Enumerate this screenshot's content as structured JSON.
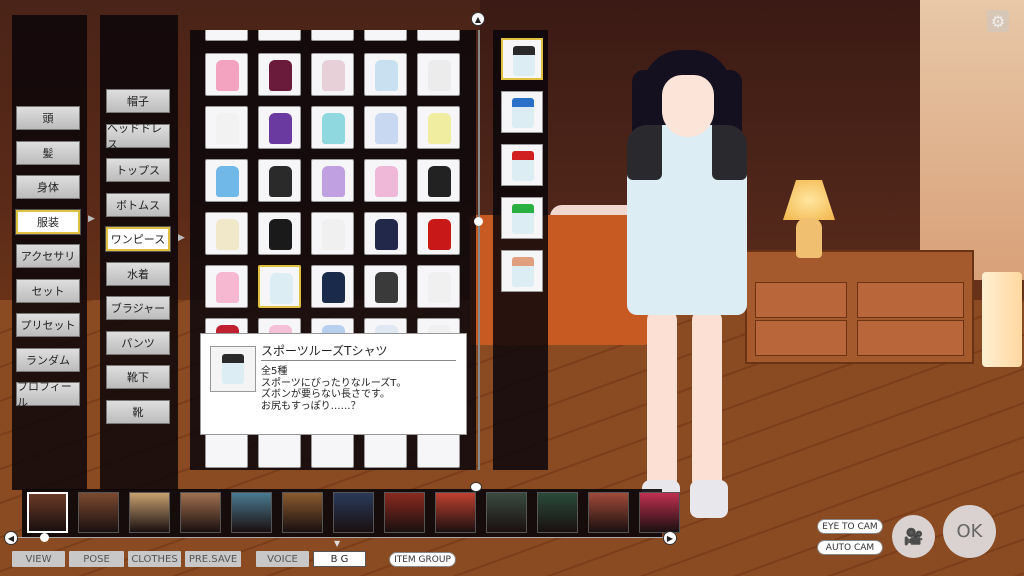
{
  "categories": [
    "頭",
    "髪",
    "身体",
    "服装",
    "アクセサリ",
    "セット",
    "プリセット",
    "ランダム",
    "プロフィール"
  ],
  "category_selected": 3,
  "subcategories": [
    "帽子",
    "ヘッドドレス",
    "トップス",
    "ボトムス",
    "ワンピース",
    "水着",
    "ブラジャー",
    "パンツ",
    "靴下",
    "靴"
  ],
  "subcategory_selected": 4,
  "item_colors": [
    [
      "#f3a3c0",
      "#6a1a3a",
      "#e8d0d8",
      "#c8e0f0",
      "#ececec"
    ],
    [
      "#f2f2f2",
      "#6a3aa0",
      "#90d8e0",
      "#c8d8f0",
      "#f0eca0"
    ],
    [
      "#70b8e8",
      "#2a2a2a",
      "#c0a0e0",
      "#f0b8d8",
      "#222222"
    ],
    [
      "#f0e8c8",
      "#1a1a1a",
      "#f0f0f0",
      "#22284a",
      "#c81818"
    ],
    [
      "#f6b8d0",
      "#dceef4",
      "#1a2a4a",
      "#3a3a3a",
      "#f0f0f0"
    ],
    [
      "#c02030",
      "#f4c0d8",
      "#b8d0f0",
      "#e0e8f4",
      "#f0f0f0"
    ]
  ],
  "color_swatch_sleeves": [
    "#2a2a2a",
    "#2a70c8",
    "#d02020",
    "#2ab040",
    "#e0a080"
  ],
  "color_selected": 0,
  "tooltip": {
    "title": "スポーツルーズTシャツ",
    "line1": "全5種",
    "line2": "スポーツにぴったりなルーズT。",
    "line3": "ズボンが要らない長さです。",
    "line4": "お尻もすっぽり……？"
  },
  "bg_thumbs": [
    "#6a3a28",
    "#7a4a30",
    "#c8a070",
    "#a07050",
    "#4a7a90",
    "#8a5a30",
    "#2a3a5a",
    "#8a2a20",
    "#c04030",
    "#3a4a40",
    "#2a4a3a",
    "#a04a3a",
    "#c03050"
  ],
  "bg_selected": 0,
  "tabs": [
    "VIEW",
    "POSE",
    "CLOTHES",
    "PRE.SAVE",
    "VOICE",
    "B G",
    "ITEM GROUP"
  ],
  "tab_selected": 5,
  "eye_to_cam": "EYE TO CAM",
  "auto_cam": "AUTO CAM",
  "ok": "OK",
  "colors": {
    "accent": "#e0c040",
    "panel": "#0a060a"
  }
}
